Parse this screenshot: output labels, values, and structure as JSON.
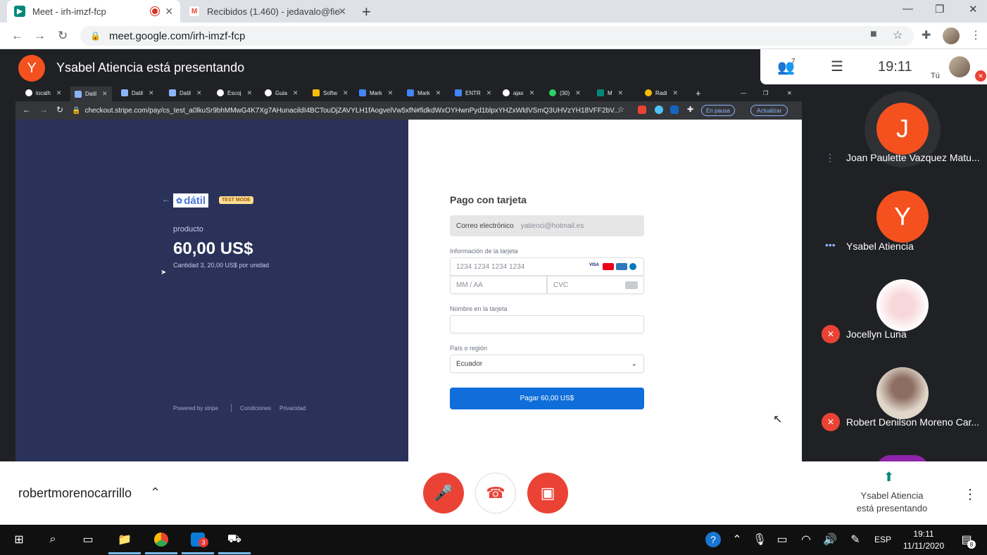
{
  "browser": {
    "tabs": [
      {
        "title": "Meet - irh-imzf-fcp",
        "active": true
      },
      {
        "title": "Recibidos (1.460) - jedavalo@fie",
        "active": false
      }
    ],
    "url": "meet.google.com/irh-imzf-fcp"
  },
  "meet": {
    "presenter_initial": "Y",
    "presenter_title": "Ysabel Atiencia está presentando",
    "people_count": "7",
    "clock": "19:11",
    "self_label": "Tú",
    "meeting_code": "robertmorenocarrillo",
    "presenting_label_line1": "Ysabel Atiencia",
    "presenting_label_line2": "está presentando",
    "participants": [
      {
        "initial": "J",
        "name": "Joan Paulette Vazquez Matu...",
        "color": "#f4511e"
      },
      {
        "initial": "Y",
        "name": "Ysabel Atiencia",
        "color": "#f4511e"
      },
      {
        "initial": "",
        "name": "Jocellyn Luna",
        "color": "#f3e5e5"
      },
      {
        "initial": "",
        "name": "Robert Denilson Moreno Car...",
        "color": "#d7cfc3"
      }
    ]
  },
  "shared_screen": {
    "tabs": [
      "localh",
      "Datil",
      "Datil",
      "Datil",
      "Escoj",
      "Guia",
      "Softw",
      "Mark",
      "Mark",
      "ENTR",
      "ajax",
      "(30)",
      "M",
      "Radi"
    ],
    "url": "checkout.stripe.com/pay/cs_test_a0lkuSr9bhMMwG4K7Xg7AHunacildI4BCTouDjZAVYLH1fAogvelVw5xfN#fidkdWxOYHwnPyd1blpxYHZxWldVSmQ3UHVzYH18VFF2bV...",
    "en_pausa": "En pausa",
    "actualizar": "Actualizar",
    "checkout": {
      "brand": "dátil",
      "test_mode": "TEST MODE",
      "product": "producto",
      "price": "60,00 US$",
      "quantity": "Cantidad 3, 20,00 US$ por unidad",
      "powered_by": "Powered by stripe",
      "conditions": "Condiciones",
      "privacy": "Privacidad",
      "form_title": "Pago con tarjeta",
      "email_label": "Correo electrónico",
      "email_value": "yatienci@hotmail.es",
      "card_info_label": "Información de la tarjeta",
      "card_number_placeholder": "1234 1234 1234 1234",
      "expiry_placeholder": "MM / AA",
      "cvc_placeholder": "CVC",
      "name_label": "Nombre en la tarjeta",
      "country_label": "País o región",
      "country_value": "Ecuador",
      "pay_button": "Pagar 60,00 US$"
    }
  },
  "taskbar": {
    "time": "19:11",
    "date": "11/11/2020",
    "lang": "ESP",
    "badge_count": "3",
    "notif_count": "8"
  }
}
